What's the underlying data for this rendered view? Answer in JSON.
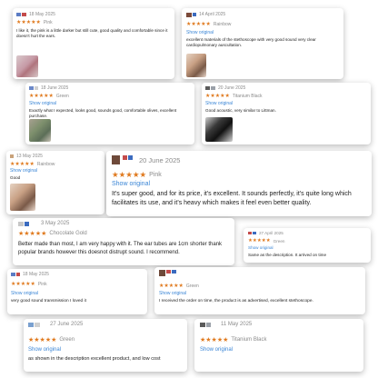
{
  "reviews": [
    {
      "date": "18 May 2025",
      "stars": "★★★★★",
      "color": "Pink",
      "show": "",
      "text": "I like it, the pink is a little darker but still cute, good quality and comfortable since it doesn't hurt the ears."
    },
    {
      "date": "14 April 2025",
      "stars": "★★★★★",
      "color": "Rainbow",
      "show": "Show original",
      "text": "excellent materials of the stethoscope with very good sound very clear cardiopulmonary auscultation."
    },
    {
      "date": "18 June 2025",
      "stars": "★★★★★",
      "color": "Green",
      "show": "Show original",
      "text": "Exactly what I expected, looks good, sounds good, comfortable olives, excellent purchase."
    },
    {
      "date": "20 June 2025",
      "stars": "★★★★★",
      "color": "Titanium Black",
      "show": "Show original",
      "text": "Good acoustic, very similar to Littman."
    },
    {
      "date": "13 May 2025",
      "stars": "★★★★★",
      "color": "Rainbow",
      "show": "Show original",
      "text": "Good"
    },
    {
      "date": "20 June 2025",
      "stars": "★★★★★",
      "color": "Pink",
      "show": "Show original",
      "text": "It's super good, and for its price, it's excellent. It sounds perfectly, it's quite long which facilitates its use, and it's heavy which makes it feel even better quality."
    },
    {
      "date": "3 May 2025",
      "stars": "★★★★★",
      "color": "Chocolate Gold",
      "show": "",
      "text": "Better made than most, I am very happy with it.   The ear tubes are 1cm shorter thank popular brands however this doesnot distrupt sound. I recommend."
    },
    {
      "date": "27 April 2025",
      "stars": "★★★★★",
      "color": "Green",
      "show": "Show original",
      "text": "Same as the description. It arrived on time"
    },
    {
      "date": "18 May 2025",
      "stars": "★★★★★",
      "color": "Pink",
      "show": "Show original",
      "text": "very good sound transmission I loved it"
    },
    {
      "date": "",
      "stars": "★★★★★",
      "color": "Green",
      "show": "Show original",
      "text": "I received the order on time, the product is as advertised, excellent stethoscope."
    },
    {
      "date": "27 June 2025",
      "stars": "★★★★★",
      "color": "Green",
      "show": "Show original",
      "text": "as shown in the description excellent product, and low cost"
    },
    {
      "date": "11 May 2025",
      "stars": "★★★★★",
      "color": "Titanium Black",
      "show": "Show original",
      "text": ""
    }
  ]
}
